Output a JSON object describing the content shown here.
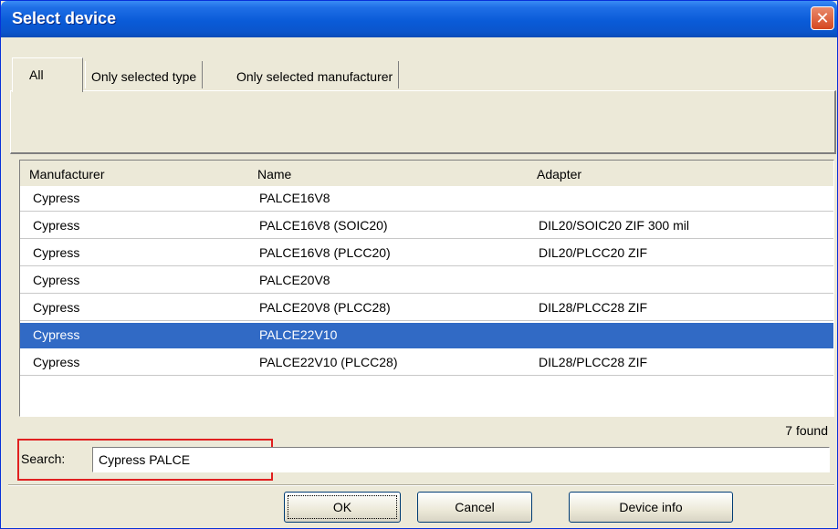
{
  "window": {
    "title": "Select device"
  },
  "tabs": [
    {
      "label": "All",
      "active": true
    },
    {
      "label": "Only selected type",
      "active": false
    },
    {
      "label": "Only selected manufacturer",
      "active": false
    }
  ],
  "list": {
    "columns": [
      "Manufacturer",
      "Name",
      "Adapter"
    ],
    "rows": [
      {
        "manufacturer": "Cypress",
        "name": "PALCE16V8",
        "adapter": ""
      },
      {
        "manufacturer": "Cypress",
        "name": "PALCE16V8 (SOIC20)",
        "adapter": "DIL20/SOIC20 ZIF 300 mil"
      },
      {
        "manufacturer": "Cypress",
        "name": "PALCE16V8 (PLCC20)",
        "adapter": "DIL20/PLCC20 ZIF"
      },
      {
        "manufacturer": "Cypress",
        "name": "PALCE20V8",
        "adapter": ""
      },
      {
        "manufacturer": "Cypress",
        "name": "PALCE20V8 (PLCC28)",
        "adapter": "DIL28/PLCC28 ZIF"
      },
      {
        "manufacturer": "Cypress",
        "name": "PALCE22V10",
        "adapter": "",
        "selected": true
      },
      {
        "manufacturer": "Cypress",
        "name": "PALCE22V10 (PLCC28)",
        "adapter": "DIL28/PLCC28 ZIF"
      }
    ],
    "found_count": "7 found"
  },
  "search": {
    "label": "Search:",
    "value": "Cypress PALCE"
  },
  "buttons": {
    "ok": "OK",
    "cancel": "Cancel",
    "device_info": "Device info"
  },
  "colors": {
    "selection": "#316ac5",
    "highlight": "#e02020",
    "titlebar": "#0a5bd8"
  }
}
